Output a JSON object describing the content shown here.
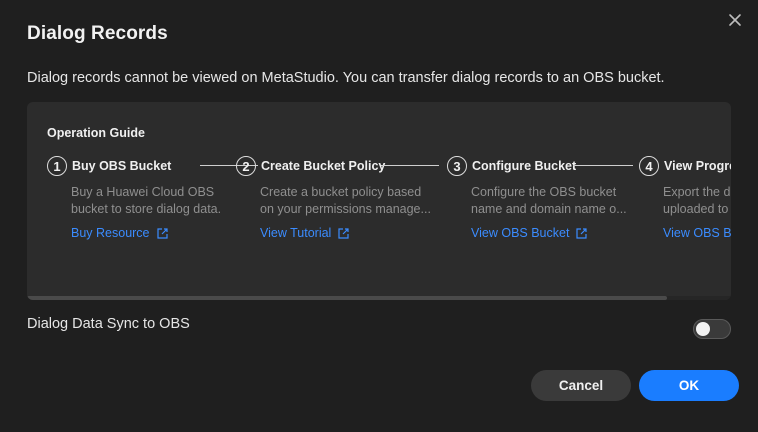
{
  "dialog": {
    "title": "Dialog Records",
    "description": "Dialog records cannot be viewed on MetaStudio. You can transfer dialog records to an OBS bucket.",
    "close_icon": "close-icon"
  },
  "guide": {
    "title": "Operation Guide",
    "steps": [
      {
        "num": "1",
        "name": "Buy OBS Bucket",
        "line1": "Buy a Huawei Cloud OBS",
        "line2": "bucket to store dialog data.",
        "link": "Buy Resource"
      },
      {
        "num": "2",
        "name": "Create Bucket Policy",
        "line1": "Create a bucket policy based",
        "line2": "on your permissions manage...",
        "link": "View Tutorial"
      },
      {
        "num": "3",
        "name": "Configure Bucket",
        "line1": "Configure the OBS bucket",
        "line2": "name and domain name o...",
        "link": "View OBS Bucket"
      },
      {
        "num": "4",
        "name": "View Progress",
        "line1": "Export the dialog data",
        "line2": "uploaded to the OBS bucket.",
        "link": "View OBS Bucket"
      }
    ],
    "link_icon": "external-link-icon"
  },
  "sync": {
    "label": "Dialog Data Sync to OBS",
    "enabled": false
  },
  "footer": {
    "cancel_label": "Cancel",
    "ok_label": "OK"
  },
  "colors": {
    "accent": "#1a7dff",
    "link": "#3b8cff",
    "background": "#1f1f1f",
    "panel": "#2c2c2c"
  }
}
